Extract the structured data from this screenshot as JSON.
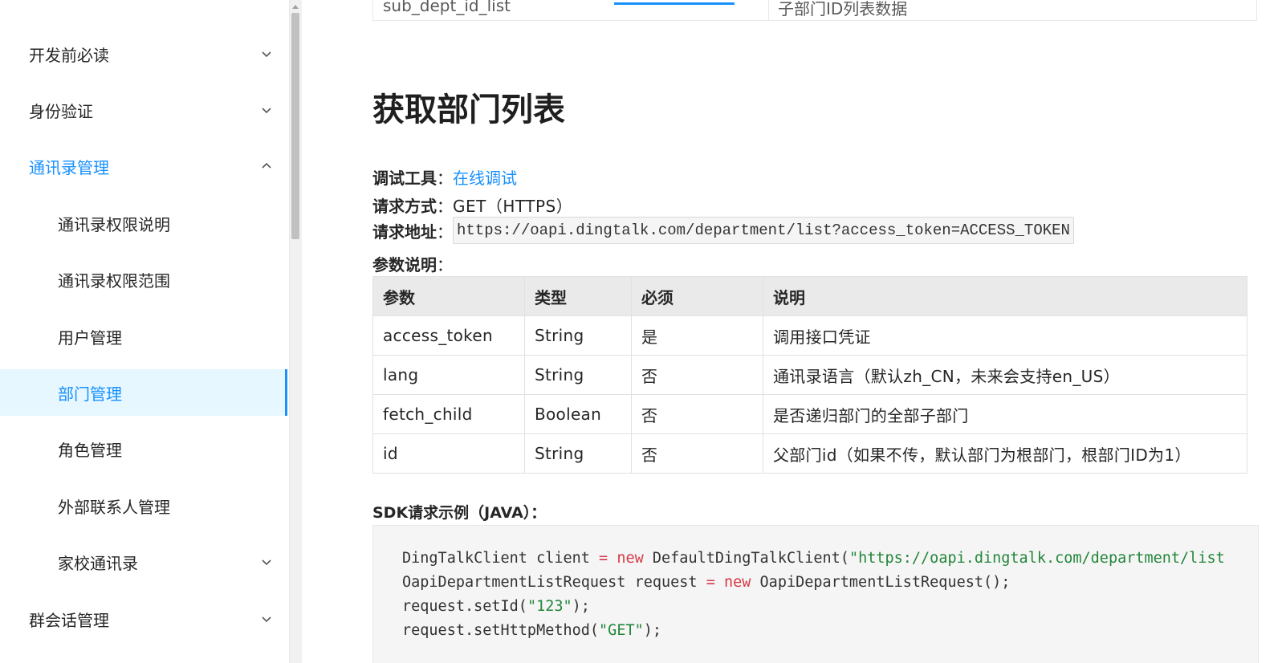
{
  "sidebar": {
    "items": [
      {
        "label": "开发前必读",
        "level": 1,
        "state": "collapsed",
        "chevron": "chevron-down-icon"
      },
      {
        "label": "身份验证",
        "level": 1,
        "state": "collapsed",
        "chevron": "chevron-down-icon"
      },
      {
        "label": "通讯录管理",
        "level": 1,
        "state": "expanded",
        "chevron": "chevron-up-icon"
      },
      {
        "label": "通讯录权限说明",
        "level": 2
      },
      {
        "label": "通讯录权限范围",
        "level": 2
      },
      {
        "label": "用户管理",
        "level": 2
      },
      {
        "label": "部门管理",
        "level": 2,
        "state": "active"
      },
      {
        "label": "角色管理",
        "level": 2
      },
      {
        "label": "外部联系人管理",
        "level": 2
      },
      {
        "label": "家校通讯录",
        "level": 2,
        "state": "collapsed",
        "chevron": "chevron-down-icon"
      },
      {
        "label": "群会话管理",
        "level": 1,
        "state": "collapsed",
        "chevron": "chevron-down-icon"
      }
    ]
  },
  "prev_table": {
    "param": "sub_dept_id_list",
    "desc": "子部门ID列表数据"
  },
  "main": {
    "title": "获取部门列表",
    "debug_tool": {
      "key": "调试工具",
      "link": "在线调试"
    },
    "method": {
      "key": "请求方式",
      "value": "GET（HTTPS）"
    },
    "url": {
      "key": "请求地址",
      "value": "https://oapi.dingtalk.com/department/list?access_token=ACCESS_TOKEN"
    },
    "params_label": "参数说明",
    "colon": "：",
    "table": {
      "headers": [
        "参数",
        "类型",
        "必须",
        "说明"
      ],
      "rows": [
        [
          "access_token",
          "String",
          "是",
          "调用接口凭证"
        ],
        [
          "lang",
          "String",
          "否",
          "通讯录语言（默认zh_CN，未来会支持en_US）"
        ],
        [
          "fetch_child",
          "Boolean",
          "否",
          "是否递归部门的全部子部门"
        ],
        [
          "id",
          "String",
          "否",
          "父部门id（如果不传，默认部门为根部门，根部门ID为1）"
        ]
      ]
    },
    "sdk_title": "SDK请求示例（JAVA）：",
    "code": {
      "l1_a": "DingTalkClient client ",
      "l1_op": "=",
      "l1_sp": " ",
      "l1_kw": "new",
      "l1_b": " DefaultDingTalkClient(",
      "l1_str": "\"https://oapi.dingtalk.com/department/list",
      "l2_a": "OapiDepartmentListRequest request ",
      "l2_op": "=",
      "l2_sp": " ",
      "l2_kw": "new",
      "l2_b": " OapiDepartmentListRequest();",
      "l3_a": "request.setId(",
      "l3_str": "\"123\"",
      "l3_b": ");",
      "l4_a": "request.setHttpMethod(",
      "l4_str": "\"GET\"",
      "l4_b": ");"
    }
  },
  "colors": {
    "accent": "#1890ff",
    "active_bg": "#e6f7ff",
    "keyword": "#d73a49",
    "string": "#22863a"
  }
}
